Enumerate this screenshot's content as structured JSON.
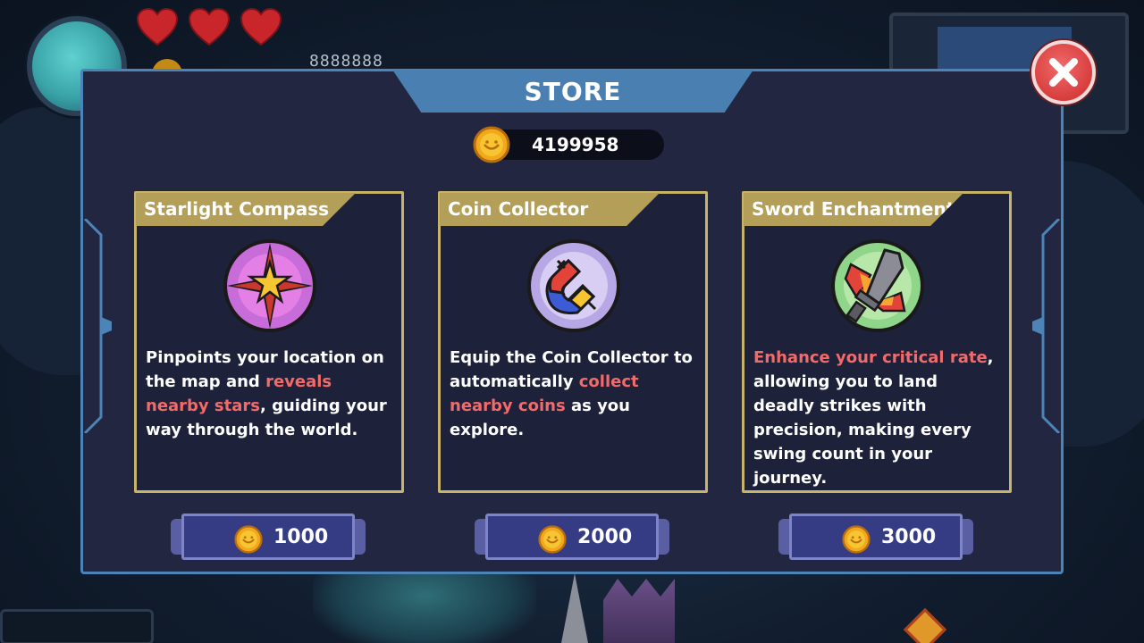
{
  "hud": {
    "score": "8888888",
    "hearts": 3
  },
  "store": {
    "title": "STORE",
    "balance": "4199958",
    "close_icon": "close-x-icon"
  },
  "items": [
    {
      "name": "Starlight Compass",
      "icon": "compass-star-icon",
      "desc": [
        {
          "t": "Pinpoints your location on the map and ",
          "hl": false
        },
        {
          "t": "reveals nearby stars",
          "hl": true
        },
        {
          "t": ", guiding your way through the world.",
          "hl": false
        }
      ],
      "price": "1000"
    },
    {
      "name": "Coin Collector",
      "icon": "magnet-icon",
      "desc": [
        {
          "t": "Equip the Coin Collector to automatically ",
          "hl": false
        },
        {
          "t": "collect nearby coins",
          "hl": true
        },
        {
          "t": " as you explore.",
          "hl": false
        }
      ],
      "price": "2000"
    },
    {
      "name": "Sword Enchantment",
      "icon": "sword-enchant-icon",
      "desc": [
        {
          "t": "Enhance your critical rate",
          "hl": true
        },
        {
          "t": ", allowing you to land deadly strikes with precision, making every swing count in your journey.",
          "hl": false
        }
      ],
      "price": "3000"
    }
  ],
  "colors": {
    "highlight": "#f26a6a",
    "panel_border": "#4c84b7",
    "card_border": "#c7b46a",
    "title_bar": "#4a7fb2"
  }
}
